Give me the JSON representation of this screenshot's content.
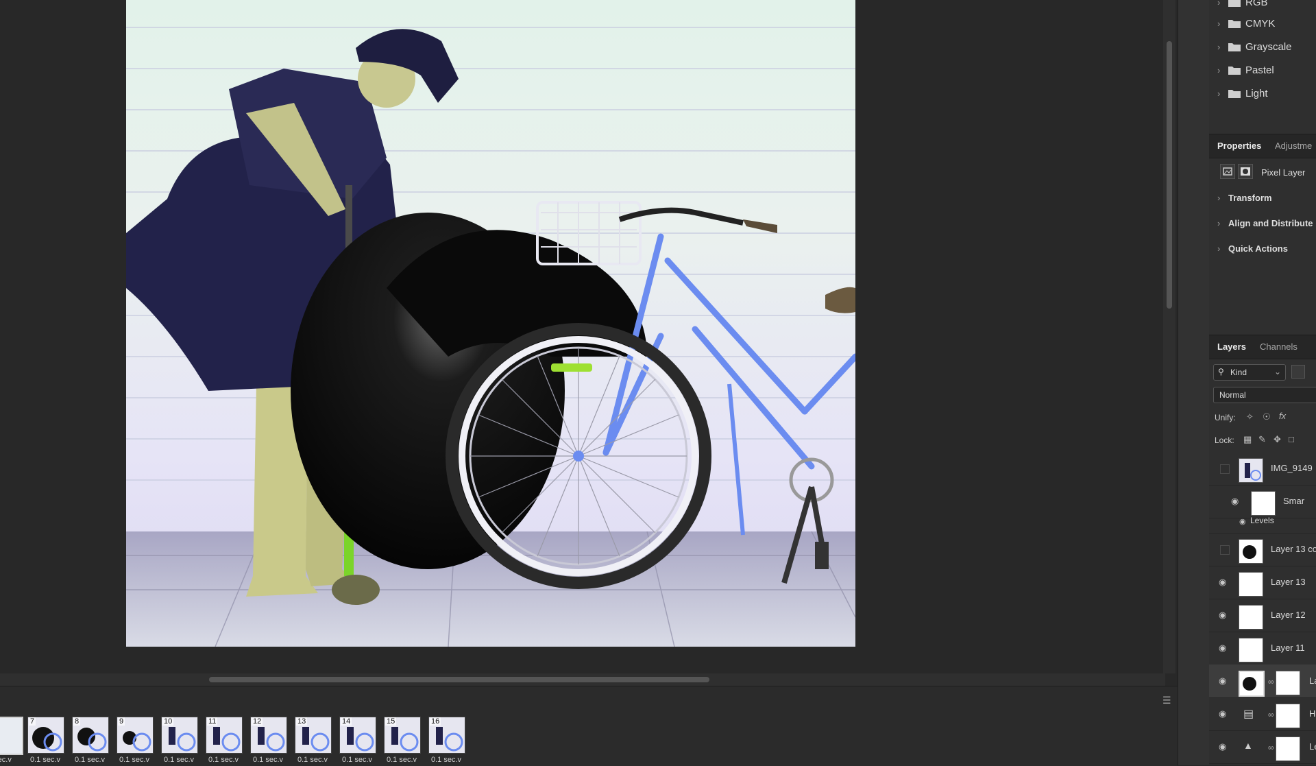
{
  "swatch_groups": [
    {
      "label": "RGB"
    },
    {
      "label": "CMYK"
    },
    {
      "label": "Grayscale"
    },
    {
      "label": "Pastel"
    },
    {
      "label": "Light"
    }
  ],
  "properties": {
    "tab_active": "Properties",
    "tab_other": "Adjustme",
    "layer_type": "Pixel Layer",
    "sections": [
      "Transform",
      "Align and Distribute",
      "Quick Actions"
    ]
  },
  "layers_panel": {
    "tab_active": "Layers",
    "tab_other": "Channels",
    "filter_label": "Kind",
    "blend_mode": "Normal",
    "unify_label": "Unify:",
    "lock_label": "Lock:",
    "layers": [
      {
        "name": "IMG_9149",
        "visible": false
      },
      {
        "name": "Smar",
        "visible": true
      },
      {
        "name": "Levels",
        "visible": true
      },
      {
        "name": "Layer 13 co",
        "visible": false
      },
      {
        "name": "Layer 13",
        "visible": true
      },
      {
        "name": "Layer 12",
        "visible": true
      },
      {
        "name": "Layer 11",
        "visible": true
      },
      {
        "name": "La",
        "visible": true
      },
      {
        "name": "H",
        "visible": true
      },
      {
        "name": "Le",
        "visible": true
      }
    ]
  },
  "timeline": {
    "frames": [
      {
        "number": "",
        "delay": "sec.v"
      },
      {
        "number": "7",
        "delay": "0.1 sec.v"
      },
      {
        "number": "8",
        "delay": "0.1 sec.v"
      },
      {
        "number": "9",
        "delay": "0.1 sec.v"
      },
      {
        "number": "10",
        "delay": "0.1 sec.v"
      },
      {
        "number": "11",
        "delay": "0.1 sec.v"
      },
      {
        "number": "12",
        "delay": "0.1 sec.v"
      },
      {
        "number": "13",
        "delay": "0.1 sec.v"
      },
      {
        "number": "14",
        "delay": "0.1 sec.v"
      },
      {
        "number": "15",
        "delay": "0.1 sec.v"
      },
      {
        "number": "16",
        "delay": "0.1 sec.v"
      }
    ]
  },
  "icons": {
    "folder": "folder-icon",
    "chevron": "chevron-right-icon",
    "eye": "eye-icon",
    "search": "search-icon",
    "link": "link-icon",
    "menu": "panel-menu-icon"
  },
  "colors": {
    "accent_bike": "#6b8cf0",
    "pump_green": "#8de030",
    "tire_black": "#0a0a0a"
  }
}
